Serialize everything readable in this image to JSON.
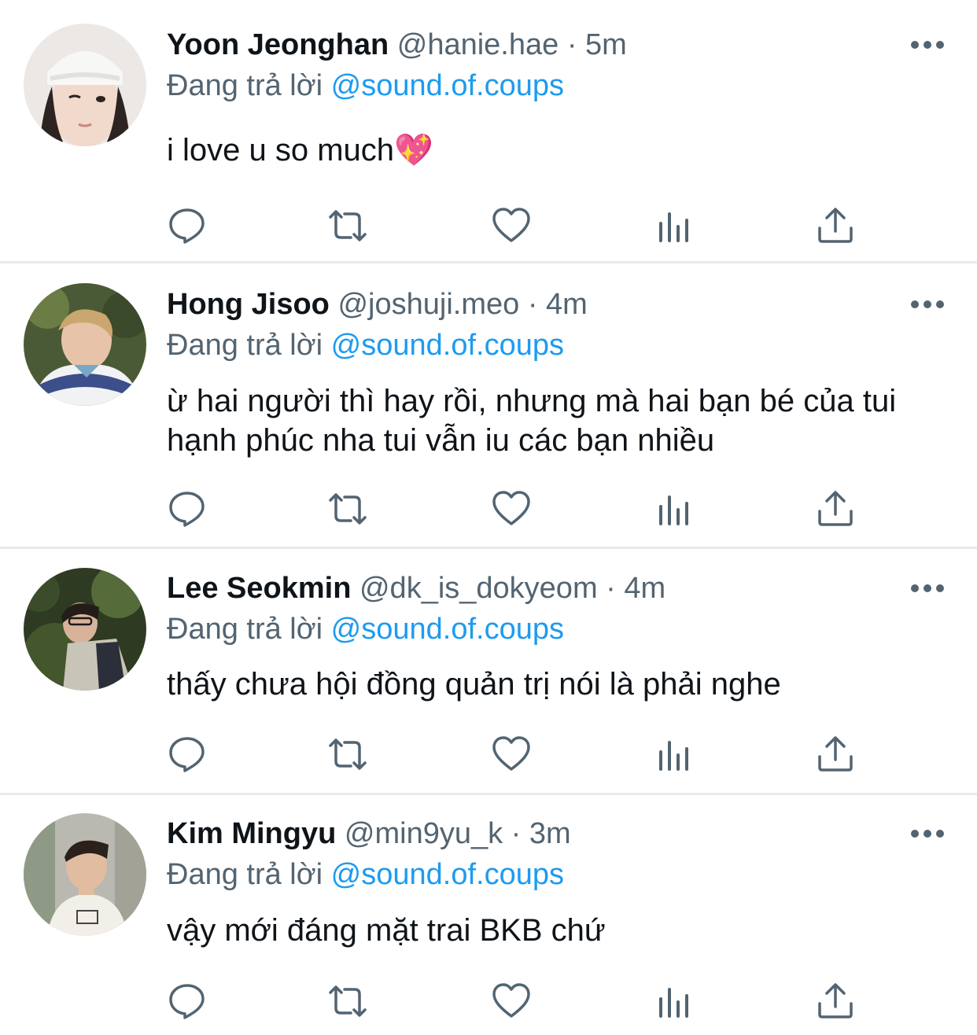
{
  "replying_prefix": "Đang trả lời",
  "colors": {
    "accent": "#1d9bf0",
    "secondary_text": "#536471",
    "divider": "#e7e9ea"
  },
  "icons": {
    "reply": "reply-icon",
    "retweet": "retweet-icon",
    "like": "heart-icon",
    "views": "views-icon",
    "share": "share-icon",
    "more": "more-icon"
  },
  "tweets": [
    {
      "name": "Yoon Jeonghan",
      "handle": "@hanie.hae",
      "time": "· 5m",
      "replying_to": "@sound.of.coups",
      "text": "i love u so much💖"
    },
    {
      "name": "Hong Jisoo",
      "handle": "@joshuji.meo",
      "time": "· 4m",
      "replying_to": "@sound.of.coups",
      "text": "ừ hai người thì hay rồi, nhưng mà hai bạn bé của tui hạnh phúc nha tui vẫn iu các bạn nhiều"
    },
    {
      "name": "Lee Seokmin",
      "handle": "@dk_is_dokyeom",
      "time": "· 4m",
      "replying_to": "@sound.of.coups",
      "text": "thấy chưa hội đồng quản trị nói là phải nghe"
    },
    {
      "name": "Kim Mingyu",
      "handle": "@min9yu_k",
      "time": "· 3m",
      "replying_to": "@sound.of.coups",
      "text": "vậy mới đáng mặt trai BKB chứ"
    }
  ]
}
